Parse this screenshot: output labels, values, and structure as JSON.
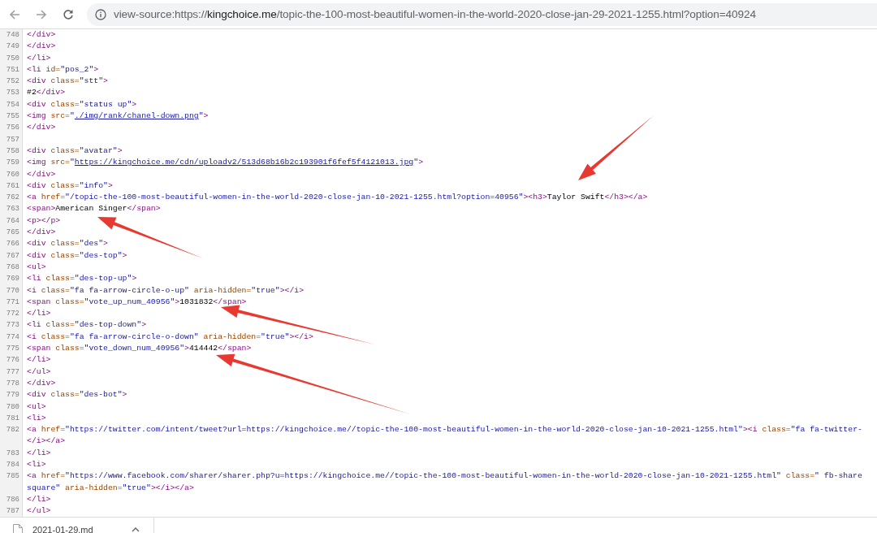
{
  "toolbar": {
    "address": {
      "scheme": "view-source:https://",
      "host": "kingchoice.me",
      "path": "/topic-the-100-most-beautiful-women-in-the-world-2020-close-jan-29-2021-1255.html?option=40924"
    }
  },
  "source_lines": [
    {
      "number": "748",
      "segments": [
        {
          "kind": "tag",
          "text": "</div>"
        }
      ]
    },
    {
      "number": "749",
      "segments": [
        {
          "kind": "tag",
          "text": "</div>"
        }
      ]
    },
    {
      "number": "750",
      "segments": [
        {
          "kind": "tag",
          "text": "</li>"
        }
      ]
    },
    {
      "number": "751",
      "segments": [
        {
          "kind": "tag",
          "text": "<li "
        },
        {
          "kind": "attr",
          "text": "id="
        },
        {
          "kind": "value",
          "text": "\"pos_2\""
        },
        {
          "kind": "tag",
          "text": ">"
        }
      ]
    },
    {
      "number": "752",
      "segments": [
        {
          "kind": "tag",
          "text": "<div "
        },
        {
          "kind": "attr",
          "text": "class="
        },
        {
          "kind": "value",
          "text": "\"stt\""
        },
        {
          "kind": "tag",
          "text": ">"
        }
      ]
    },
    {
      "number": "753",
      "segments": [
        {
          "kind": "text",
          "text": "#2"
        },
        {
          "kind": "tag",
          "text": "</div>"
        }
      ]
    },
    {
      "number": "754",
      "segments": [
        {
          "kind": "tag",
          "text": "<div "
        },
        {
          "kind": "attr",
          "text": "class="
        },
        {
          "kind": "value",
          "text": "\"status up\""
        },
        {
          "kind": "tag",
          "text": ">"
        }
      ]
    },
    {
      "number": "755",
      "segments": [
        {
          "kind": "tag",
          "text": "<img "
        },
        {
          "kind": "attr",
          "text": "src="
        },
        {
          "kind": "value",
          "text": "\""
        },
        {
          "kind": "link",
          "text": "./img/rank/chanel-down.png"
        },
        {
          "kind": "value",
          "text": "\""
        },
        {
          "kind": "tag",
          "text": ">"
        }
      ]
    },
    {
      "number": "756",
      "segments": [
        {
          "kind": "tag",
          "text": "</div>"
        }
      ]
    },
    {
      "number": "757"
    },
    {
      "number": "758",
      "segments": [
        {
          "kind": "tag",
          "text": "<div "
        },
        {
          "kind": "attr",
          "text": "class="
        },
        {
          "kind": "value",
          "text": "\"avatar\""
        },
        {
          "kind": "tag",
          "text": ">"
        }
      ]
    },
    {
      "number": "759",
      "segments": [
        {
          "kind": "tag",
          "text": "<img "
        },
        {
          "kind": "attr",
          "text": "src="
        },
        {
          "kind": "value",
          "text": "\""
        },
        {
          "kind": "link",
          "text": "https://kingchoice.me/cdn/uploadv2/513d68b16b2c193901f6fef5f4121013.jpg"
        },
        {
          "kind": "value",
          "text": "\""
        },
        {
          "kind": "tag",
          "text": ">"
        }
      ]
    },
    {
      "number": "760",
      "segments": [
        {
          "kind": "tag",
          "text": "</div>"
        }
      ]
    },
    {
      "number": "761",
      "segments": [
        {
          "kind": "tag",
          "text": "<div "
        },
        {
          "kind": "attr",
          "text": "class="
        },
        {
          "kind": "value",
          "text": "\"info\""
        },
        {
          "kind": "tag",
          "text": ">"
        }
      ]
    },
    {
      "number": "762",
      "segments": [
        {
          "kind": "tag",
          "text": "<a "
        },
        {
          "kind": "attr",
          "text": "href="
        },
        {
          "kind": "value",
          "text": "\"/topic-the-100-most-beautiful-women-in-the-world-2020-close-jan-10-2021-1255.html?option=40956\""
        },
        {
          "kind": "tag",
          "text": "><h3>"
        },
        {
          "kind": "text",
          "text": "Taylor Swift"
        },
        {
          "kind": "tag",
          "text": "</h3></a>"
        }
      ]
    },
    {
      "number": "763",
      "segments": [
        {
          "kind": "tag",
          "text": "<span>"
        },
        {
          "kind": "text",
          "text": "American Singer"
        },
        {
          "kind": "tag",
          "text": "</span>"
        }
      ]
    },
    {
      "number": "764",
      "segments": [
        {
          "kind": "tag",
          "text": "<p></p>"
        }
      ]
    },
    {
      "number": "765",
      "segments": [
        {
          "kind": "tag",
          "text": "</div>"
        }
      ]
    },
    {
      "number": "766",
      "segments": [
        {
          "kind": "tag",
          "text": "<div "
        },
        {
          "kind": "attr",
          "text": "class="
        },
        {
          "kind": "value",
          "text": "\"des\""
        },
        {
          "kind": "tag",
          "text": ">"
        }
      ]
    },
    {
      "number": "767",
      "segments": [
        {
          "kind": "tag",
          "text": "<div "
        },
        {
          "kind": "attr",
          "text": "class="
        },
        {
          "kind": "value",
          "text": "\"des-top\""
        },
        {
          "kind": "tag",
          "text": ">"
        }
      ]
    },
    {
      "number": "768",
      "segments": [
        {
          "kind": "tag",
          "text": "<ul>"
        }
      ]
    },
    {
      "number": "769",
      "segments": [
        {
          "kind": "tag",
          "text": "<li "
        },
        {
          "kind": "attr",
          "text": "class="
        },
        {
          "kind": "value",
          "text": "\"des-top-up\""
        },
        {
          "kind": "tag",
          "text": ">"
        }
      ]
    },
    {
      "number": "770",
      "segments": [
        {
          "kind": "tag",
          "text": "<i "
        },
        {
          "kind": "attr",
          "text": "class="
        },
        {
          "kind": "value",
          "text": "\"fa fa-arrow-circle-o-up\""
        },
        {
          "kind": "attr",
          "text": " aria-hidden="
        },
        {
          "kind": "value",
          "text": "\"true\""
        },
        {
          "kind": "tag",
          "text": "></i>"
        }
      ]
    },
    {
      "number": "771",
      "segments": [
        {
          "kind": "tag",
          "text": "<span "
        },
        {
          "kind": "attr",
          "text": "class="
        },
        {
          "kind": "value",
          "text": "\"vote_up_num_40956\""
        },
        {
          "kind": "tag",
          "text": ">"
        },
        {
          "kind": "text",
          "text": "1031832"
        },
        {
          "kind": "tag",
          "text": "</span>"
        }
      ]
    },
    {
      "number": "772",
      "segments": [
        {
          "kind": "tag",
          "text": "</li>"
        }
      ]
    },
    {
      "number": "773",
      "segments": [
        {
          "kind": "tag",
          "text": "<li "
        },
        {
          "kind": "attr",
          "text": "class="
        },
        {
          "kind": "value",
          "text": "\"des-top-down\""
        },
        {
          "kind": "tag",
          "text": ">"
        }
      ]
    },
    {
      "number": "774",
      "segments": [
        {
          "kind": "tag",
          "text": "<i "
        },
        {
          "kind": "attr",
          "text": "class="
        },
        {
          "kind": "value",
          "text": "\"fa fa-arrow-circle-o-down\""
        },
        {
          "kind": "attr",
          "text": " aria-hidden="
        },
        {
          "kind": "value",
          "text": "\"true\""
        },
        {
          "kind": "tag",
          "text": "></i>"
        }
      ]
    },
    {
      "number": "775",
      "segments": [
        {
          "kind": "tag",
          "text": "<span "
        },
        {
          "kind": "attr",
          "text": "class="
        },
        {
          "kind": "value",
          "text": "\"vote_down_num_40956\""
        },
        {
          "kind": "tag",
          "text": ">"
        },
        {
          "kind": "text",
          "text": "414442"
        },
        {
          "kind": "tag",
          "text": "</span>"
        }
      ]
    },
    {
      "number": "776",
      "segments": [
        {
          "kind": "tag",
          "text": "</li>"
        }
      ]
    },
    {
      "number": "777",
      "segments": [
        {
          "kind": "tag",
          "text": "</ul>"
        }
      ]
    },
    {
      "number": "778",
      "segments": [
        {
          "kind": "tag",
          "text": "</div>"
        }
      ]
    },
    {
      "number": "779",
      "segments": [
        {
          "kind": "tag",
          "text": "<div "
        },
        {
          "kind": "attr",
          "text": "class="
        },
        {
          "kind": "value",
          "text": "\"des-bot\""
        },
        {
          "kind": "tag",
          "text": ">"
        }
      ]
    },
    {
      "number": "780",
      "segments": [
        {
          "kind": "tag",
          "text": "<ul>"
        }
      ]
    },
    {
      "number": "781",
      "segments": [
        {
          "kind": "tag",
          "text": "<li>"
        }
      ]
    },
    {
      "number": "782",
      "segments": [
        {
          "kind": "tag",
          "text": "<a "
        },
        {
          "kind": "attr",
          "text": "href="
        },
        {
          "kind": "value",
          "text": "\"https://twitter.com/intent/tweet?url=https://kingchoice.me//topic-the-100-most-beautiful-women-in-the-world-2020-close-jan-10-2021-1255.html\""
        },
        {
          "kind": "tag",
          "text": "><i "
        },
        {
          "kind": "attr",
          "text": "class="
        },
        {
          "kind": "value",
          "text": "\"fa fa-twitter-"
        }
      ]
    },
    {
      "segments": [
        {
          "kind": "tag",
          "text": "</i></a>"
        }
      ]
    },
    {
      "number": "783",
      "segments": [
        {
          "kind": "tag",
          "text": "</li>"
        }
      ]
    },
    {
      "number": "784",
      "segments": [
        {
          "kind": "tag",
          "text": "<li>"
        }
      ]
    },
    {
      "number": "785",
      "segments": [
        {
          "kind": "tag",
          "text": "<a "
        },
        {
          "kind": "attr",
          "text": "href="
        },
        {
          "kind": "value",
          "text": "\"https://www.facebook.com/sharer/sharer.php?u=https://kingchoice.me//topic-the-100-most-beautiful-women-in-the-world-2020-close-jan-10-2021-1255.html\""
        },
        {
          "kind": "attr",
          "text": " class="
        },
        {
          "kind": "value",
          "text": "\" fb-share"
        }
      ]
    },
    {
      "segments": [
        {
          "kind": "value",
          "text": "square\""
        },
        {
          "kind": "attr",
          "text": " aria-hidden="
        },
        {
          "kind": "value",
          "text": "\"true\""
        },
        {
          "kind": "tag",
          "text": "></i></a>"
        }
      ]
    },
    {
      "number": "786",
      "segments": [
        {
          "kind": "tag",
          "text": "</li>"
        }
      ]
    },
    {
      "number": "787",
      "segments": [
        {
          "kind": "tag",
          "text": "</ul>"
        }
      ]
    }
  ],
  "download_bar": {
    "file_name": "2021-01-29.md"
  }
}
